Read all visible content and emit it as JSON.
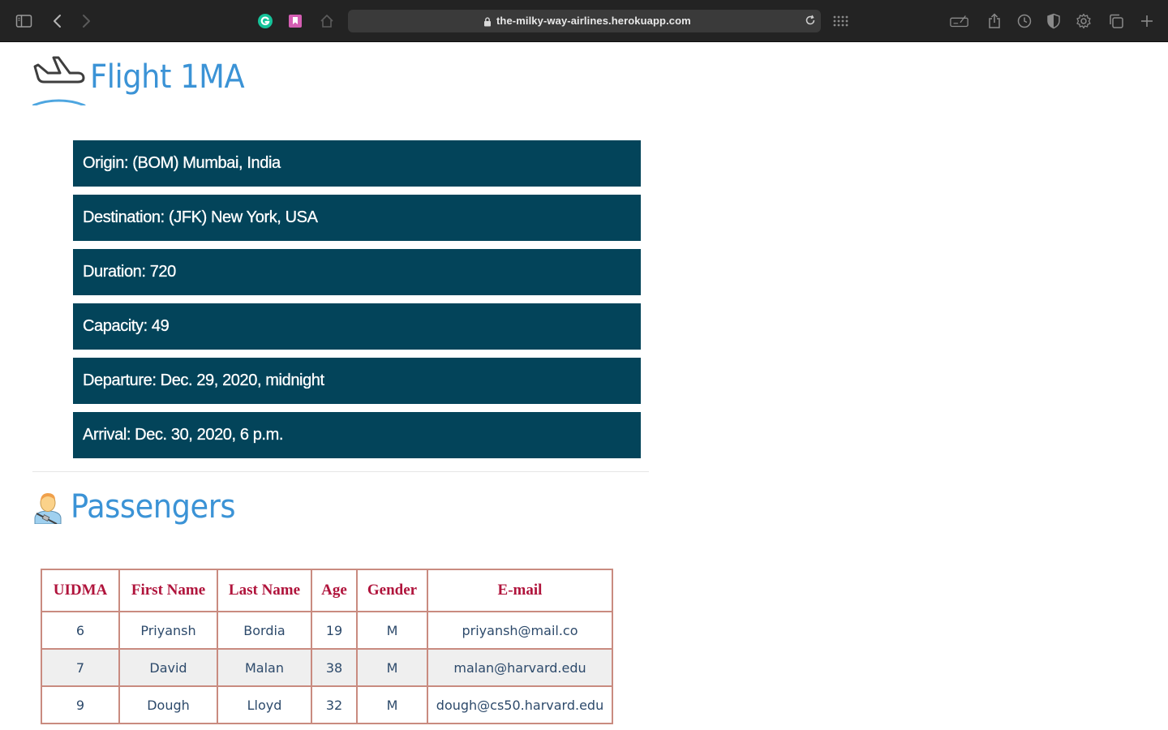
{
  "browser": {
    "url": "the-milky-way-airlines.herokuapp.com"
  },
  "flight": {
    "title": "Flight 1MA",
    "details": [
      "Origin: (BOM) Mumbai, India",
      "Destination: (JFK) New York, USA",
      "Duration: 720",
      "Capacity: 49",
      "Departure: Dec. 29, 2020, midnight",
      "Arrival: Dec. 30, 2020, 6 p.m."
    ]
  },
  "passengers": {
    "title": "Passengers",
    "columns": [
      "UIDMA",
      "First Name",
      "Last Name",
      "Age",
      "Gender",
      "E-mail"
    ],
    "rows": [
      [
        "6",
        "Priyansh",
        "Bordia",
        "19",
        "M",
        "priyansh@mail.co"
      ],
      [
        "7",
        "David",
        "Malan",
        "38",
        "M",
        "malan@harvard.edu"
      ],
      [
        "9",
        "Dough",
        "Lloyd",
        "32",
        "M",
        "dough@cs50.harvard.edu"
      ]
    ]
  },
  "colors": {
    "accent": "#3b93d6",
    "detail_bg": "#03445a",
    "table_header": "#b0143c",
    "table_border": "#c98b80"
  }
}
